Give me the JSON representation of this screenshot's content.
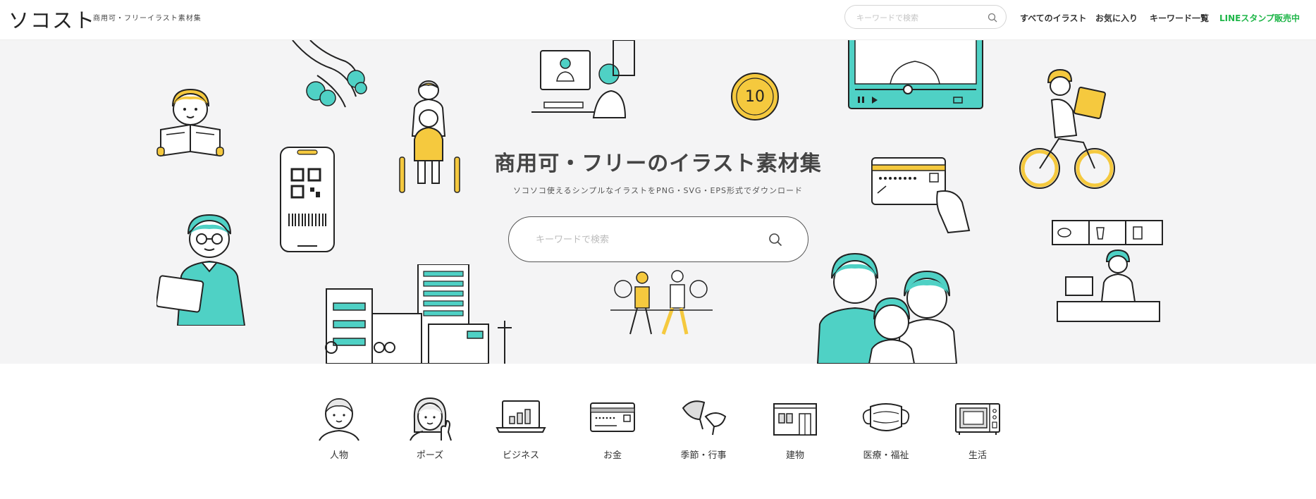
{
  "header": {
    "logo": "ソコスト",
    "tagline": "商用可・フリーイラスト素材集",
    "search_placeholder": "キーワードで検索",
    "nav": [
      {
        "label": "すべてのイラスト"
      },
      {
        "label": "お気に入り"
      },
      {
        "label": "キーワード一覧"
      },
      {
        "label": "LINEスタンプ販売中"
      }
    ]
  },
  "hero": {
    "title": "商用可・フリーのイラスト素材集",
    "subtitle": "ソコソコ使えるシンプルなイラストをPNG・SVG・EPS形式でダウンロード",
    "search_placeholder": "キーワードで検索",
    "coin_text": "10"
  },
  "categories": [
    {
      "label": "人物",
      "icon": "person-icon"
    },
    {
      "label": "ポーズ",
      "icon": "pose-icon"
    },
    {
      "label": "ビジネス",
      "icon": "business-laptop-icon"
    },
    {
      "label": "お金",
      "icon": "money-card-icon"
    },
    {
      "label": "季節・行事",
      "icon": "ginkgo-leaf-icon"
    },
    {
      "label": "建物",
      "icon": "building-icon"
    },
    {
      "label": "医療・福祉",
      "icon": "mask-icon"
    },
    {
      "label": "生活",
      "icon": "microwave-icon"
    }
  ],
  "colors": {
    "teal": "#4fd1c5",
    "yellow": "#f5c93e",
    "line_green": "#1fb649",
    "hero_bg": "#f4f4f5"
  }
}
